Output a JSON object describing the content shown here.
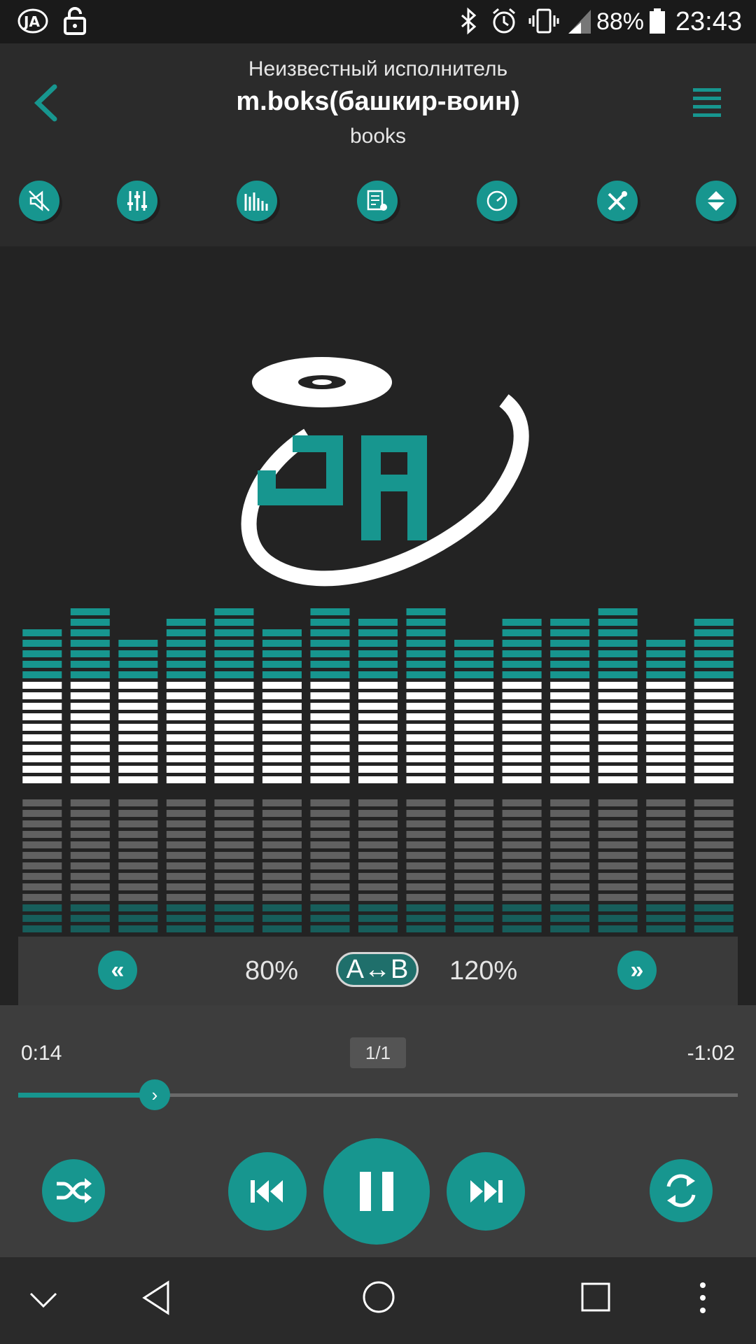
{
  "status_bar": {
    "time": "23:43",
    "battery": "88%"
  },
  "header": {
    "artist": "Неизвестный исполнитель",
    "title": "m.boks(башкир-воин)",
    "album": "books"
  },
  "toolbar": {
    "icons": [
      "speaker-off-icon",
      "equalizer-icon",
      "visualizer-icon",
      "lyrics-icon",
      "timer-icon",
      "tools-icon",
      "sort-icon"
    ]
  },
  "ab_panel": {
    "slower_label": "80%",
    "ab_label": "A↔B",
    "faster_label": "120%"
  },
  "progress": {
    "elapsed": "0:14",
    "remaining": "-1:02",
    "track_count": "1/1",
    "fraction": 0.19
  },
  "visualizer": {
    "levels": [
      15,
      17,
      14,
      16,
      17,
      15,
      17,
      16,
      17,
      14,
      16,
      16,
      17,
      14,
      16
    ]
  },
  "colors": {
    "accent": "#17968f",
    "accent_dark": "#0f5f5b",
    "background": "#232323"
  }
}
